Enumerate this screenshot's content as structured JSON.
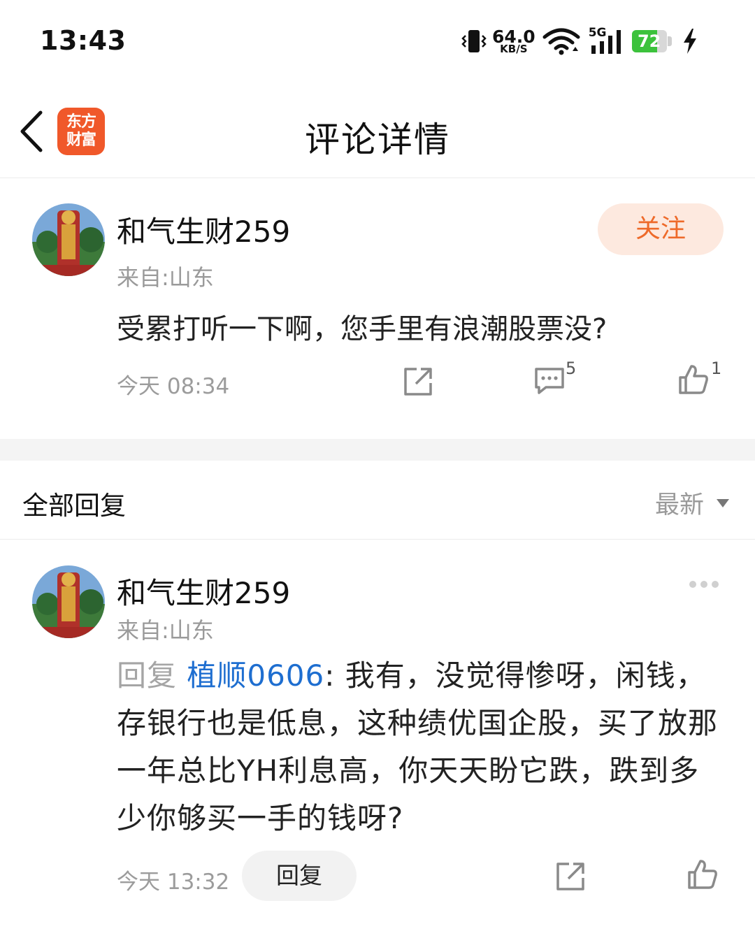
{
  "status_bar": {
    "time": "13:43",
    "net_speed_value": "64.0",
    "net_speed_unit": "KB/S",
    "network_type": "5G",
    "battery_level": "72",
    "battery_fraction": 0.72
  },
  "header": {
    "title": "评论详情",
    "app_logo_line1": "东方",
    "app_logo_line2": "财富"
  },
  "post": {
    "username": "和气生财259",
    "location": "来自:山东",
    "follow_label": "关注",
    "content": "受累打听一下啊，您手里有浪潮股票没?",
    "time": "今天 08:34",
    "comment_count": "5",
    "like_count": "1"
  },
  "replies_section": {
    "title": "全部回复",
    "sort_label": "最新"
  },
  "reply": {
    "username": "和气生财259",
    "location": "来自:山东",
    "prefix": "回复 ",
    "mention": "植顺0606",
    "separator": ": ",
    "text": "我有，没觉得惨呀，闲钱，存银行也是低息，这种绩优国企股，买了放那一年总比YH利息高，你天天盼它跌，跌到多少你够买一手的钱呀?",
    "time": "今天 13:32",
    "reply_button_label": "回复"
  },
  "colors": {
    "accent": "#ee6a2a",
    "follow_bg": "#fde9df",
    "mention": "#1e6ed0",
    "logo_bg": "#f0582a",
    "battery_fill": "#3cc23c"
  },
  "icons": [
    "vibrate-icon",
    "wifi-icon",
    "signal-icon",
    "battery-icon",
    "charging-icon",
    "back-arrow-icon",
    "share-icon",
    "comment-icon",
    "like-icon",
    "more-icon",
    "dropdown-triangle-icon"
  ]
}
